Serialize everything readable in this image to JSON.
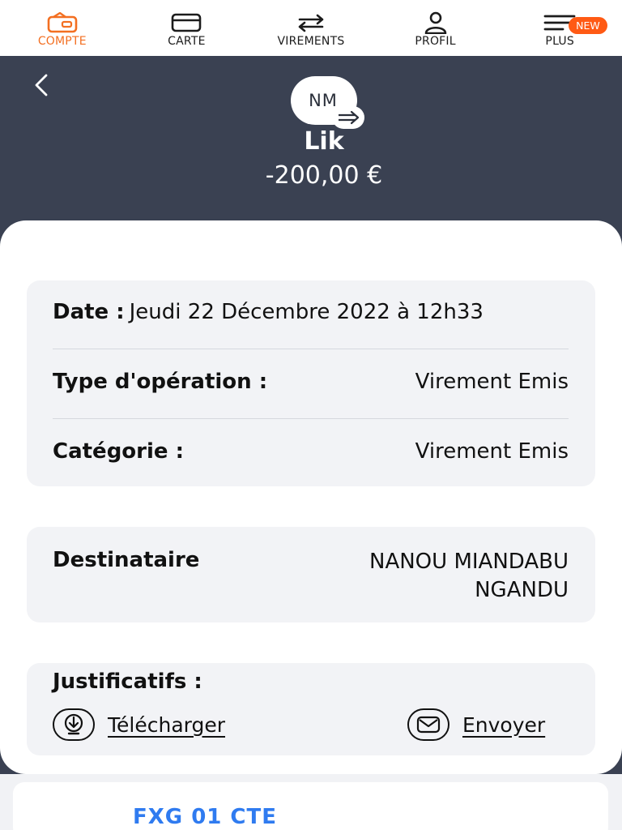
{
  "nav": {
    "items": [
      {
        "label": "COMPTE",
        "icon": "wallet-icon",
        "active": true
      },
      {
        "label": "CARTE",
        "icon": "card-icon",
        "active": false
      },
      {
        "label": "VIREMENTS",
        "icon": "transfer-arrows-icon",
        "active": false
      },
      {
        "label": "PROFIL",
        "icon": "user-icon",
        "active": false
      },
      {
        "label": "PLUS",
        "icon": "menu-icon",
        "active": false
      }
    ],
    "new_badge": "NEW"
  },
  "header": {
    "avatar_initials": "NM",
    "name": "Lik",
    "amount": "-200,00 €"
  },
  "details": {
    "date_label": "Date :",
    "date_value": "Jeudi 22 Décembre 2022 à 12h33",
    "type_label": "Type d'opération :",
    "type_value": "Virement Emis",
    "category_label": "Catégorie :",
    "category_value": "Virement Emis"
  },
  "recipient": {
    "label": "Destinataire",
    "value_line1": "NANOU MIANDABU",
    "value_line2": "NGANDU"
  },
  "documents": {
    "title": "Justificatifs :",
    "download_label": "Télécharger",
    "send_label": "Envoyer"
  },
  "colors": {
    "accent": "#f36f21",
    "header_bg": "#3a4152",
    "card_bg": "#f2f3f6",
    "link_blue": "#2f7bf0"
  },
  "bottom": {
    "partial_text": "FXG 01 CTE"
  }
}
